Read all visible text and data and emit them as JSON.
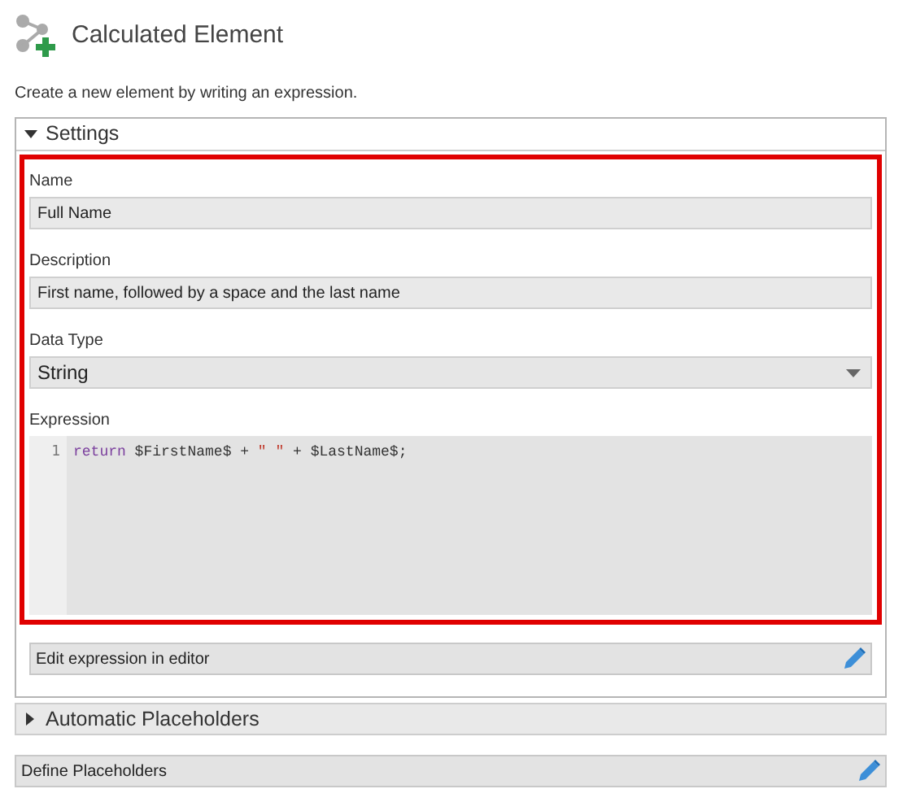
{
  "header": {
    "title": "Calculated Element",
    "subtitle": "Create a new element by writing an expression."
  },
  "settings": {
    "label": "Settings",
    "expanded": true,
    "fields": [
      {
        "kind": "text",
        "label": "Name",
        "value": "Full Name"
      },
      {
        "kind": "text",
        "label": "Description",
        "value": "First name, followed by a space and the last name"
      },
      {
        "kind": "select",
        "label": "Data Type",
        "value": "String"
      }
    ],
    "expression": {
      "label": "Expression",
      "line_number": "1",
      "tokens": [
        {
          "kind": "keyword",
          "text": "return"
        },
        {
          "kind": "plain",
          "text": " $FirstName$ + "
        },
        {
          "kind": "string",
          "text": "\" \""
        },
        {
          "kind": "plain",
          "text": " + $LastName$;"
        }
      ]
    },
    "editor_button": "Edit expression in editor"
  },
  "automatic_placeholders": {
    "label": "Automatic Placeholders",
    "expanded": false
  },
  "define_placeholders": "Define Placeholders"
}
